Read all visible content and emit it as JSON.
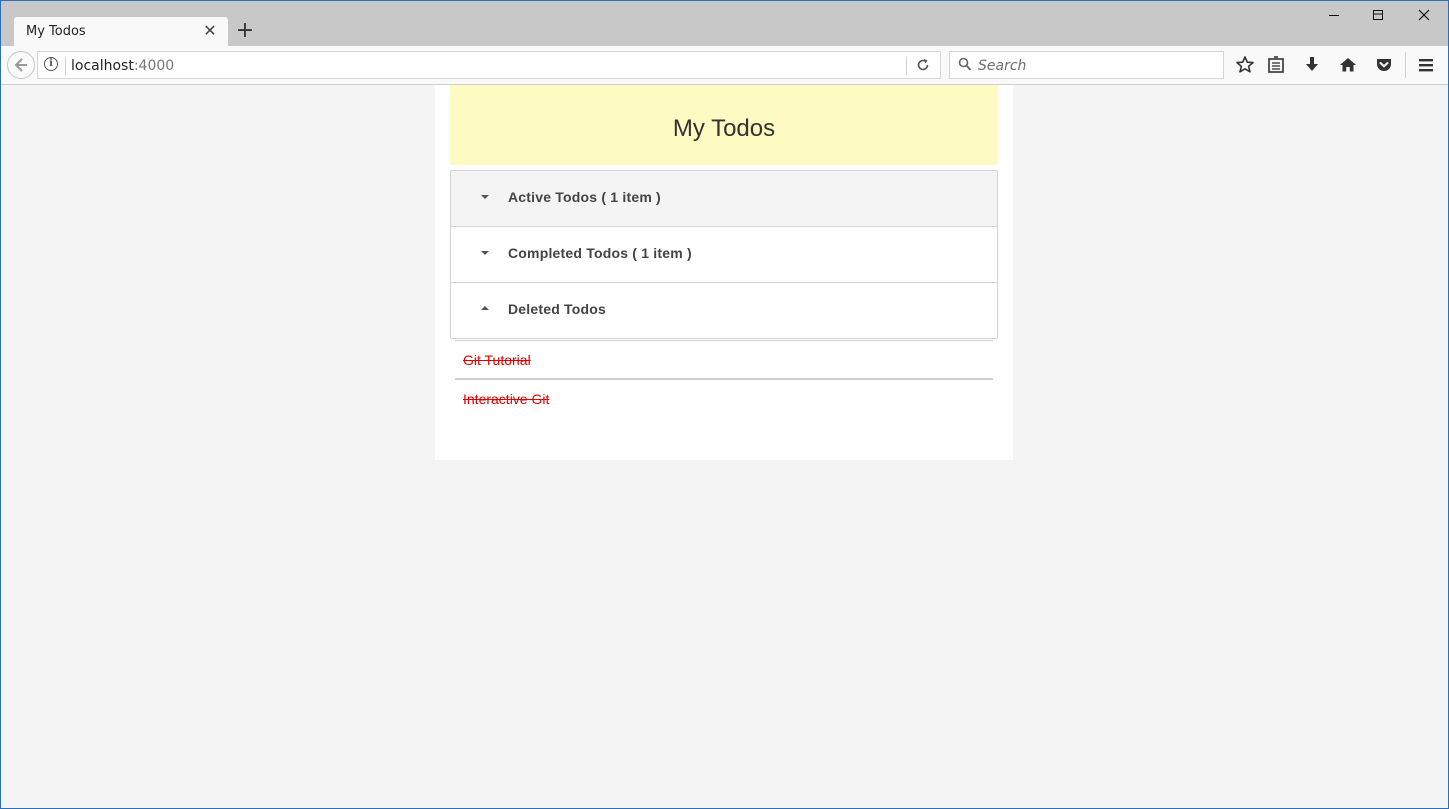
{
  "browser": {
    "tab_title": "My Todos",
    "tab_close": "✕",
    "new_tab": "+",
    "window_controls": {
      "minimize": "—",
      "maximize": "☐",
      "close": "✕"
    },
    "url_host": "localhost",
    "url_port": ":4000",
    "search_placeholder": "Search"
  },
  "app": {
    "title": "My Todos",
    "sections": [
      {
        "label": "Active Todos ( 1 item )",
        "expanded": false
      },
      {
        "label": "Completed Todos ( 1 item )",
        "expanded": false
      },
      {
        "label": "Deleted Todos",
        "expanded": true
      }
    ],
    "deleted_todos": [
      "Git Tutorial",
      "Interactive Git"
    ]
  },
  "colors": {
    "header_bg": "#fdfbc2",
    "deleted_text": "#e00000",
    "page_bg": "#f4f4f4"
  }
}
